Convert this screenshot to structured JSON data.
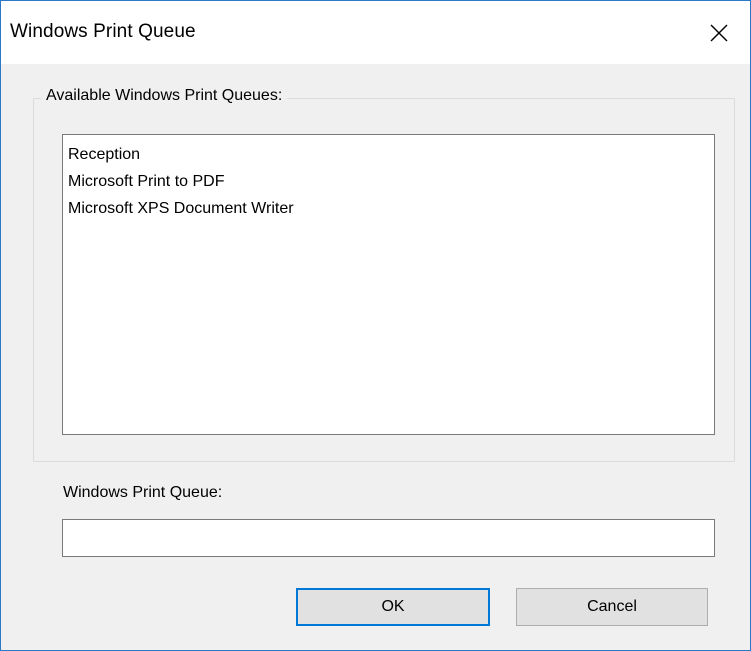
{
  "window": {
    "title": "Windows Print Queue",
    "accent_color": "#0078d7"
  },
  "titlebar": {
    "close_icon": "close-icon"
  },
  "queues_group": {
    "legend": "Available Windows Print Queues:",
    "items": [
      "Reception",
      "Microsoft Print to PDF",
      "Microsoft XPS Document Writer"
    ]
  },
  "queue_field": {
    "label": "Windows Print Queue:",
    "value": ""
  },
  "buttons": {
    "ok_label": "OK",
    "cancel_label": "Cancel"
  }
}
